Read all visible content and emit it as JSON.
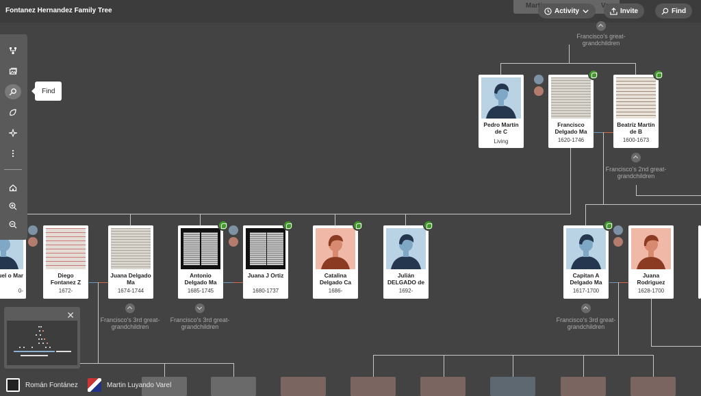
{
  "header": {
    "title": "Fontanez Hernandez Family Tree",
    "ghost_left": "Martin",
    "ghost_right": "Var",
    "activity_label": "Activity",
    "invite_label": "Invite",
    "find_label": "Find"
  },
  "toolbar": {
    "tooltip": "Find",
    "tools": [
      "tree-view-icon",
      "gallery-icon",
      "find-icon",
      "hints-icon",
      "compass-icon",
      "more-icon",
      "home-icon",
      "zoom-in-icon",
      "zoom-out-icon"
    ]
  },
  "descendants": {
    "top": "Francisco's great-grandchildren",
    "second": "Francisco's 2nd great-grandchildren",
    "third_a": "Francisco's 3rd great-grandchildren",
    "third_b": "Francisco's 3rd great-grandchildren",
    "third_c": "Francisco's 3rd great-grandchildren"
  },
  "people": {
    "pedro": {
      "name": "Pedro Martín de C",
      "dates": "Living"
    },
    "francisco": {
      "name": "Francisco Delgado Ma",
      "dates": "1620-1746"
    },
    "beatriz": {
      "name": "Beatriz Martín de B",
      "dates": "1600-1673"
    },
    "manuel": {
      "name": "uel o Mar",
      "dates": "0-"
    },
    "diego": {
      "name": "Diego Fontanez Z",
      "dates": "1672-"
    },
    "juana_d": {
      "name": "Juana Delgado Ma",
      "dates": "1674-1744"
    },
    "antonio": {
      "name": "Antonio Delgado Ma",
      "dates": "1685-1745"
    },
    "juana_o": {
      "name": "Juana J Ortiz",
      "dates": "1680-1737"
    },
    "catalina": {
      "name": "Catalina Delgado Ca",
      "dates": "1686-"
    },
    "julian": {
      "name": "Julián DELGADO de",
      "dates": "1692-"
    },
    "capitan": {
      "name": "Capitan A Delgado Ma",
      "dates": "1617-1700"
    },
    "juana_r": {
      "name": "Juana Rodriguez",
      "dates": "1628-1700"
    }
  },
  "bottom": {
    "user1": "Román Fontánez",
    "user2": "Martin Luyando Varel"
  },
  "colors": {
    "background": "#434343",
    "hint_green": "#3f9a2a",
    "male_bg": "#b9d3e4",
    "female_bg": "#f0b8a6"
  }
}
